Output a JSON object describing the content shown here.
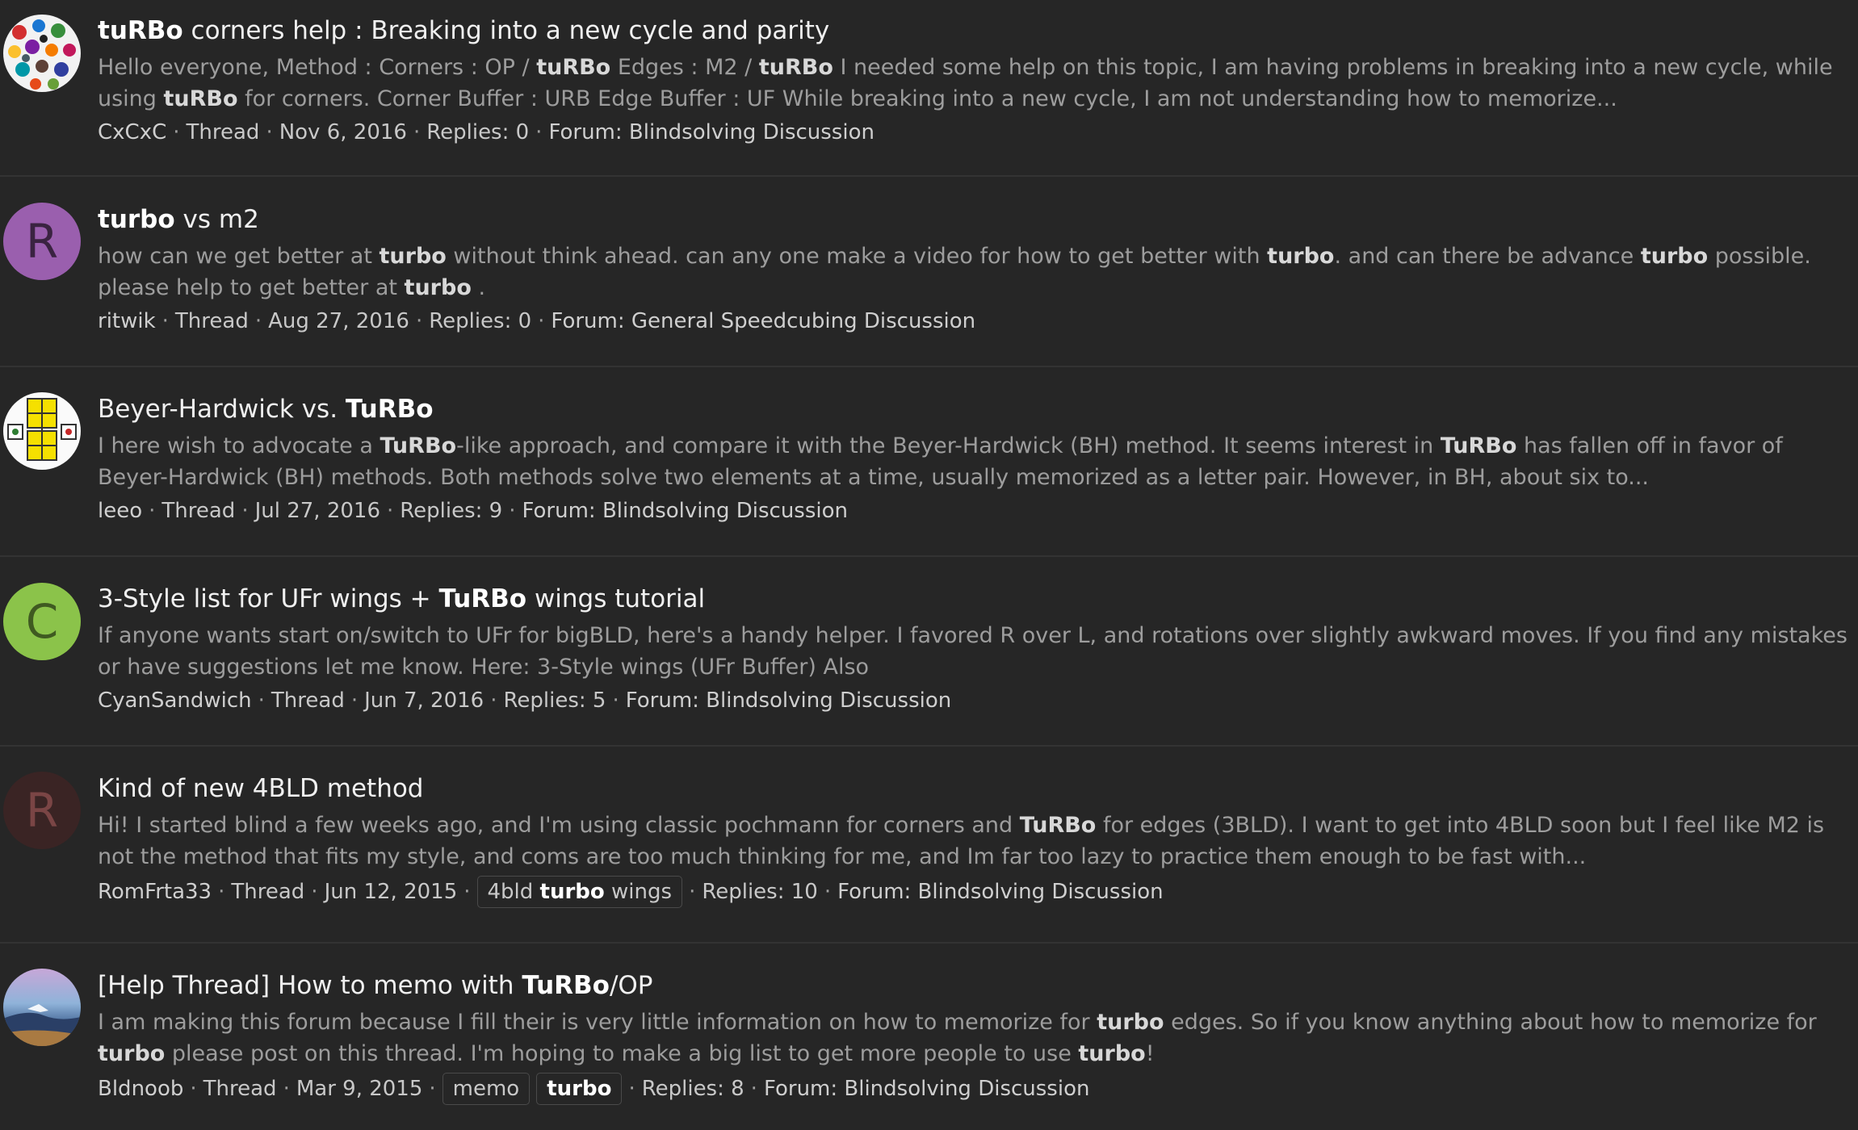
{
  "results": [
    {
      "avatar": {
        "kind": "image",
        "icon": "colorful-stickers-avatar-icon"
      },
      "title": [
        {
          "text": "tuRBo",
          "bold": true
        },
        {
          "text": " corners help : Breaking into a new cycle and parity",
          "bold": false
        }
      ],
      "snippet": [
        {
          "text": "Hello everyone, Method : Corners : OP / ",
          "bold": false
        },
        {
          "text": "tuRBo",
          "bold": true
        },
        {
          "text": " Edges : M2 / ",
          "bold": false
        },
        {
          "text": "tuRBo",
          "bold": true
        },
        {
          "text": " I needed some help on this topic, I am having problems in breaking into a new cycle, while using ",
          "bold": false
        },
        {
          "text": "tuRBo",
          "bold": true
        },
        {
          "text": " for corners. Corner Buffer : URB Edge Buffer : UF While breaking into a new cycle, I am not understanding how to memorize...",
          "bold": false
        }
      ],
      "author": "CxCxC",
      "type": "Thread",
      "date": "Nov 6, 2016",
      "tags": [],
      "replies": "Replies: 0",
      "forum": "Forum: Blindsolving Discussion"
    },
    {
      "avatar": {
        "kind": "letter",
        "letter": "R",
        "bg": "#9a5fae",
        "fg": "#3a2341"
      },
      "title": [
        {
          "text": "turbo",
          "bold": true
        },
        {
          "text": " vs m2",
          "bold": false
        }
      ],
      "snippet": [
        {
          "text": "how can we get better at ",
          "bold": false
        },
        {
          "text": "turbo",
          "bold": true
        },
        {
          "text": " without think ahead. can any one make a video for how to get better with ",
          "bold": false
        },
        {
          "text": "turbo",
          "bold": true
        },
        {
          "text": ". and can there be advance ",
          "bold": false
        },
        {
          "text": "turbo",
          "bold": true
        },
        {
          "text": " possible. please help to get better at ",
          "bold": false
        },
        {
          "text": "turbo",
          "bold": true
        },
        {
          "text": " .",
          "bold": false
        }
      ],
      "author": "ritwik",
      "type": "Thread",
      "date": "Aug 27, 2016",
      "tags": [],
      "replies": "Replies: 0",
      "forum": "Forum: General Speedcubing Discussion"
    },
    {
      "avatar": {
        "kind": "image",
        "icon": "yellow-cube-diagram-avatar-icon"
      },
      "title": [
        {
          "text": "Beyer-Hardwick vs. ",
          "bold": false
        },
        {
          "text": "TuRBo",
          "bold": true
        }
      ],
      "snippet": [
        {
          "text": "I here wish to advocate a ",
          "bold": false
        },
        {
          "text": "TuRBo",
          "bold": true
        },
        {
          "text": "-like approach, and compare it with the Beyer-Hardwick (BH) method. It seems interest in ",
          "bold": false
        },
        {
          "text": "TuRBo",
          "bold": true
        },
        {
          "text": " has fallen off in favor of Beyer-Hardwick (BH) methods. Both methods solve two elements at a time, usually memorized as a letter pair. However, in BH, about six to...",
          "bold": false
        }
      ],
      "author": "leeo",
      "type": "Thread",
      "date": "Jul 27, 2016",
      "tags": [],
      "replies": "Replies: 9",
      "forum": "Forum: Blindsolving Discussion"
    },
    {
      "avatar": {
        "kind": "letter",
        "letter": "C",
        "bg": "#8bc34a",
        "fg": "#3f5a21"
      },
      "title": [
        {
          "text": "3-Style list for UFr wings + ",
          "bold": false
        },
        {
          "text": "TuRBo",
          "bold": true
        },
        {
          "text": " wings tutorial",
          "bold": false
        }
      ],
      "snippet": [
        {
          "text": "If anyone wants start on/switch to UFr for bigBLD, here's a handy helper. I favored R over L, and rotations over slightly awkward moves. If you find any mistakes or have suggestions let me know. Here: 3-Style wings (UFr Buffer) Also",
          "bold": false
        }
      ],
      "author": "CyanSandwich",
      "type": "Thread",
      "date": "Jun 7, 2016",
      "tags": [],
      "replies": "Replies: 5",
      "forum": "Forum: Blindsolving Discussion"
    },
    {
      "avatar": {
        "kind": "letter",
        "letter": "R",
        "bg": "#3a2424",
        "fg": "#7a4545"
      },
      "title": [
        {
          "text": "Kind of new 4BLD method",
          "bold": false
        }
      ],
      "snippet": [
        {
          "text": "Hi! I started blind a few weeks ago, and I'm using classic pochmann for corners and ",
          "bold": false
        },
        {
          "text": "TuRBo",
          "bold": true
        },
        {
          "text": " for edges (3BLD). I want to get into 4BLD soon but I feel like M2 is not the method that fits my style, and coms are too much thinking for me, and Im far too lazy to practice them enough to be fast with...",
          "bold": false
        }
      ],
      "author": "RomFrta33",
      "type": "Thread",
      "date": "Jun 12, 2015",
      "tags": [
        [
          {
            "text": "4bld ",
            "bold": false
          },
          {
            "text": "turbo",
            "bold": true
          },
          {
            "text": " wings",
            "bold": false
          }
        ]
      ],
      "replies": "Replies: 10",
      "forum": "Forum: Blindsolving Discussion"
    },
    {
      "avatar": {
        "kind": "image",
        "icon": "sky-landscape-avatar-icon"
      },
      "title": [
        {
          "text": "[Help Thread] How to memo with ",
          "bold": false
        },
        {
          "text": "TuRBo",
          "bold": true
        },
        {
          "text": "/OP",
          "bold": false
        }
      ],
      "snippet": [
        {
          "text": "I am making this forum because I fill their is very little information on how to memorize for ",
          "bold": false
        },
        {
          "text": "turbo",
          "bold": true
        },
        {
          "text": " edges. So if you know anything about how to memorize for ",
          "bold": false
        },
        {
          "text": "turbo",
          "bold": true
        },
        {
          "text": " please post on this thread. I'm hoping to make a big list to get more people to use ",
          "bold": false
        },
        {
          "text": "turbo",
          "bold": true
        },
        {
          "text": "!",
          "bold": false
        }
      ],
      "author": "Bldnoob",
      "type": "Thread",
      "date": "Mar 9, 2015",
      "tags": [
        [
          {
            "text": "memo",
            "bold": false
          }
        ],
        [
          {
            "text": "turbo",
            "bold": true
          }
        ]
      ],
      "replies": "Replies: 8",
      "forum": "Forum: Blindsolving Discussion"
    }
  ]
}
